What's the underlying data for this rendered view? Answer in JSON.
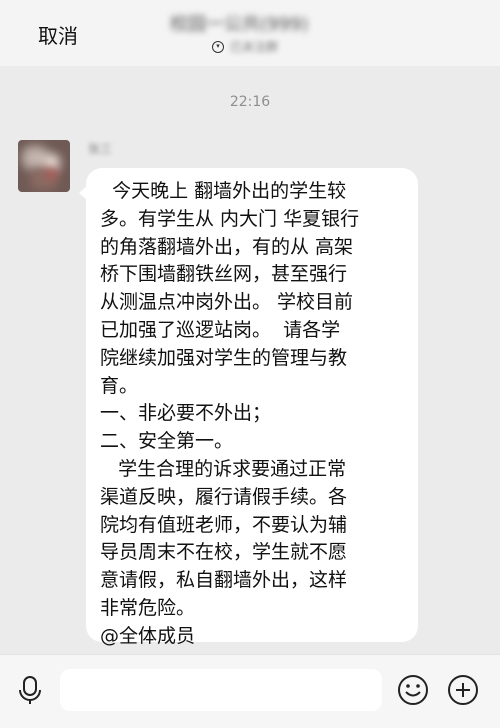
{
  "header": {
    "cancel_label": "取消",
    "title_obscured": "校园一公共(999)",
    "subtitle_obscured": "已关注群"
  },
  "timestamp": "22:16",
  "message": {
    "sender_obscured": "张三",
    "lines": [
      "  今天晚上 翻墙外出的学生较",
      "多。有学生从 内大门 华夏银行",
      "的角落翻墙外出，有的从 高架",
      "桥下围墙翻铁丝网，甚至强行",
      "从测温点冲岗外出。 学校目前",
      "已加强了巡逻站岗。  请各学",
      "院继续加强对学生的管理与教",
      "育。",
      "一、非必要不外出；",
      "二、安全第一。",
      "   学生合理的诉求要通过正常",
      "渠道反映，履行请假手续。各",
      "院均有值班老师，不要认为辅",
      "导员周末不在校，学生就不愿",
      "意请假，私自翻墙外出，这样",
      "非常危险。",
      "@全体成员"
    ]
  },
  "input": {
    "value": "",
    "placeholder": ""
  },
  "icons": {
    "voice": "microphone-icon",
    "emoji": "smiley-icon",
    "more": "plus-circle-icon"
  }
}
